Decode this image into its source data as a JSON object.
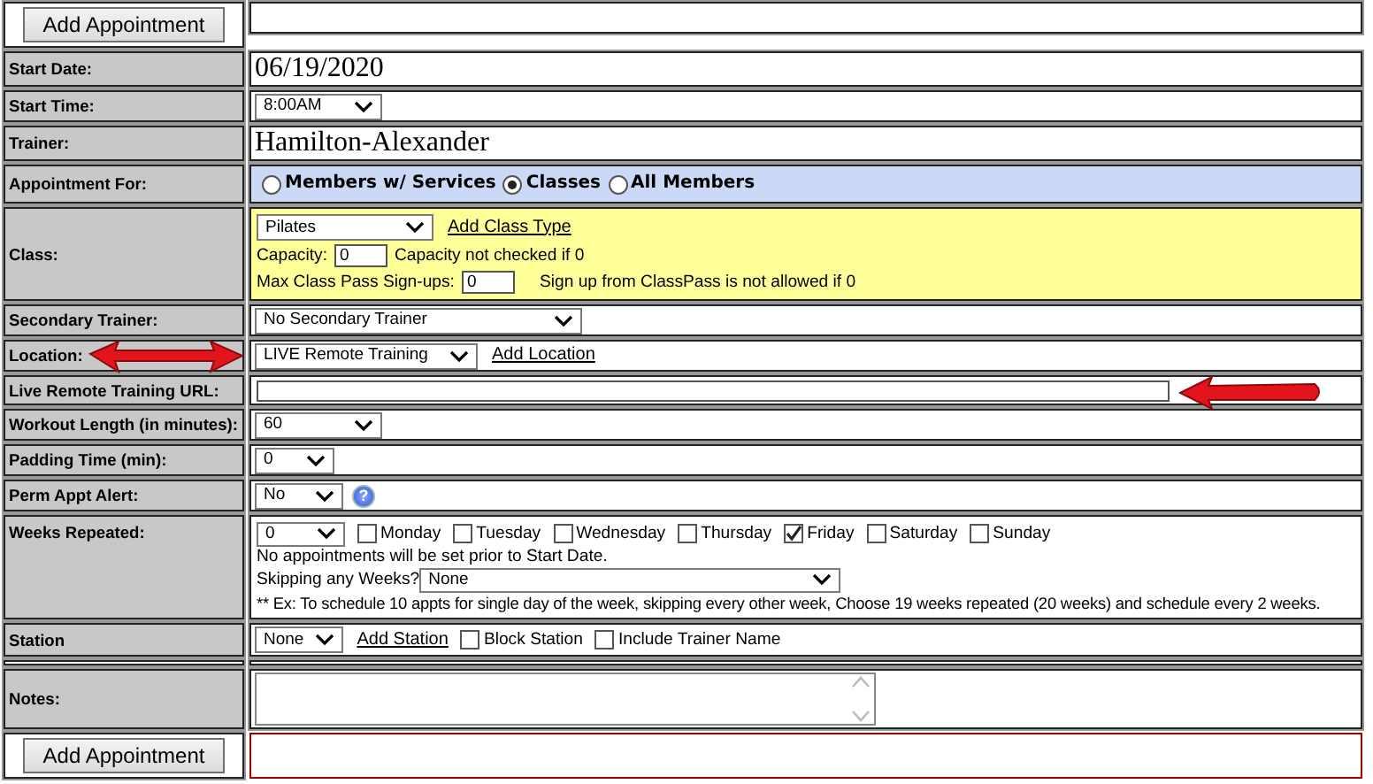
{
  "top_button": "Add Appointment",
  "fields": [
    {
      "kind": "text",
      "label": "Start Date:",
      "value": "06/19/2020"
    },
    {
      "kind": "select",
      "label": "Start Time:",
      "value": "8:00AM"
    },
    {
      "kind": "text",
      "label": "Trainer:",
      "value": "Hamilton-Alexander"
    },
    {
      "kind": "radios",
      "label": "Appointment For:",
      "options": [
        {
          "label": "Members w/ Services",
          "selected": false
        },
        {
          "label": "Classes",
          "selected": true
        },
        {
          "label": "All Members",
          "selected": false
        }
      ]
    },
    {
      "kind": "class",
      "label": "Class:",
      "value": "Pilates",
      "link": "Add Class Type",
      "capacity_label": "Capacity:",
      "capacity": "0",
      "capacity_note": "Capacity not checked if 0",
      "max_label": "Max Class Pass Sign-ups:",
      "max": "0",
      "max_note": "Sign up from ClassPass is not allowed if 0"
    },
    {
      "kind": "select",
      "label": "Secondary Trainer:",
      "value": "No Secondary Trainer"
    },
    {
      "kind": "select",
      "label": "Location:",
      "value": "LIVE Remote Training",
      "link": "Add Location"
    },
    {
      "kind": "input",
      "label": "Live Remote Training URL:"
    },
    {
      "kind": "select",
      "label": "Workout Length (in minutes):",
      "value": "60"
    },
    {
      "kind": "select",
      "label": "Padding Time (min):",
      "value": "0"
    },
    {
      "kind": "select",
      "label": "Perm Appt Alert:",
      "value": "No",
      "help": "?"
    },
    {
      "kind": "weeks",
      "label": "Weeks Repeated:",
      "value": "0",
      "days": [
        {
          "label": "Monday",
          "checked": false
        },
        {
          "label": "Tuesday",
          "checked": false
        },
        {
          "label": "Wednesday",
          "checked": false
        },
        {
          "label": "Thursday",
          "checked": false
        },
        {
          "label": "Friday",
          "checked": true
        },
        {
          "label": "Saturday",
          "checked": false
        },
        {
          "label": "Sunday",
          "checked": false
        }
      ],
      "note": "No appointments will be set prior to Start Date.",
      "skip_label": "Skipping any Weeks?",
      "skip": "None",
      "example": "** Ex: To schedule 10 appts for single day of the week, skipping every other week, Choose 19 weeks repeated (20 weeks) and schedule every 2 weeks."
    },
    {
      "kind": "station",
      "label": "Station",
      "value": "None",
      "link": "Add Station",
      "options": [
        {
          "label": "Block Station",
          "checked": false
        },
        {
          "label": "Include Trainer Name",
          "checked": false
        }
      ]
    },
    {
      "kind": "textarea",
      "label": "Notes:"
    }
  ],
  "bottom_button": "Add Appointment"
}
